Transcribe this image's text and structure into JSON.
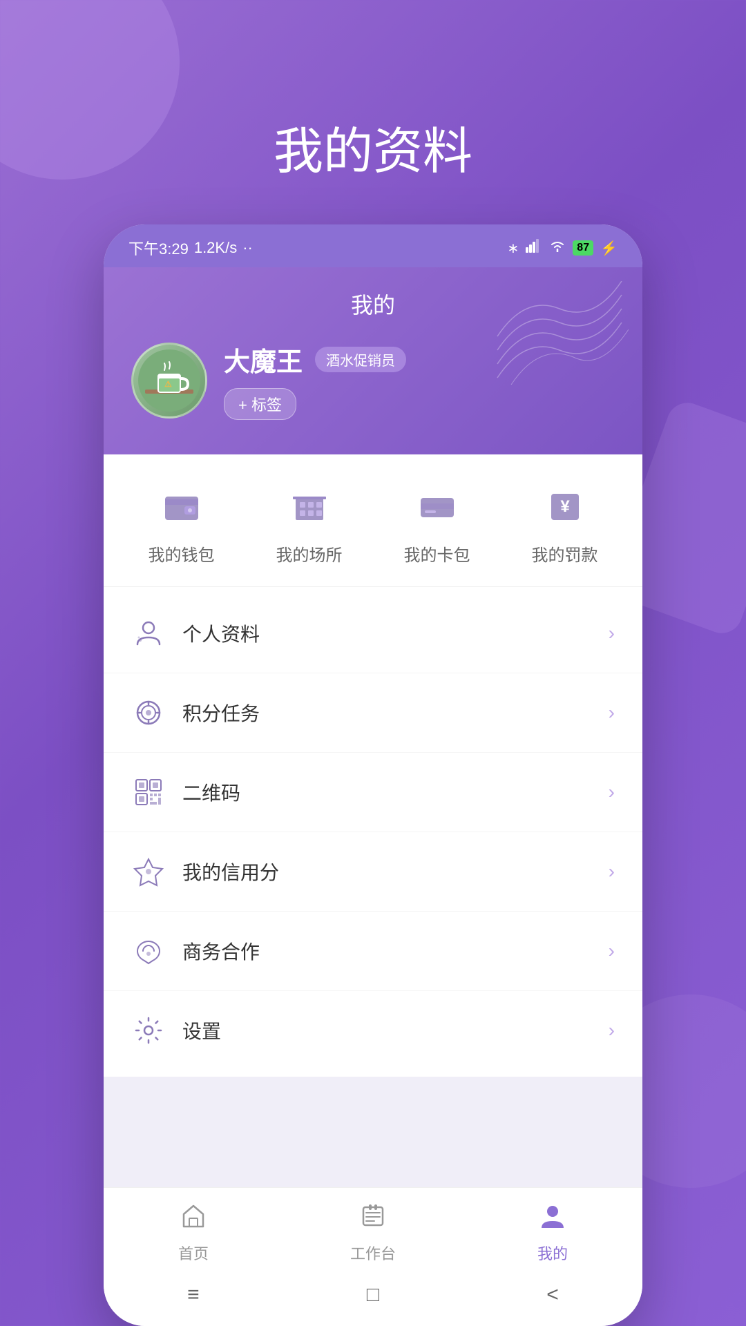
{
  "page": {
    "title": "我的资料",
    "background_color": "#8b6fd4"
  },
  "status_bar": {
    "time": "下午3:29",
    "speed": "1.2K/s",
    "battery": "87"
  },
  "profile_header": {
    "title": "我的",
    "user_name": "大魔王",
    "user_badge": "酒水促销员",
    "tag_btn": "+ 标签",
    "avatar_emoji": "☕"
  },
  "quick_access": {
    "items": [
      {
        "id": "wallet",
        "label": "我的钱包"
      },
      {
        "id": "venue",
        "label": "我的场所"
      },
      {
        "id": "card",
        "label": "我的卡包"
      },
      {
        "id": "fine",
        "label": "我的罚款"
      }
    ]
  },
  "menu": {
    "items": [
      {
        "id": "profile",
        "label": "个人资料"
      },
      {
        "id": "points",
        "label": "积分任务"
      },
      {
        "id": "qrcode",
        "label": "二维码"
      },
      {
        "id": "credit",
        "label": "我的信用分"
      },
      {
        "id": "business",
        "label": "商务合作"
      },
      {
        "id": "settings",
        "label": "设置"
      }
    ]
  },
  "bottom_nav": {
    "items": [
      {
        "id": "home",
        "label": "首页",
        "active": false
      },
      {
        "id": "workbench",
        "label": "工作台",
        "active": false
      },
      {
        "id": "mine",
        "label": "我的",
        "active": true
      }
    ]
  },
  "system_nav": {
    "menu_icon": "≡",
    "home_icon": "□",
    "back_icon": "<"
  }
}
